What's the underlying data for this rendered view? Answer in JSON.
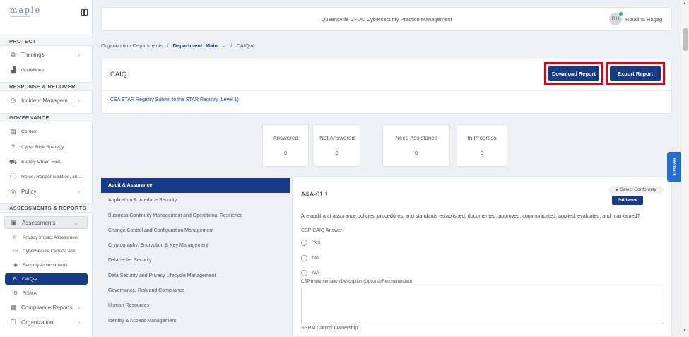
{
  "sidebar": {
    "logo": "maple",
    "sections": {
      "protect": "PROTECT",
      "respond": "RESPONSE & RECOVER",
      "governance": "GOVERNANCE",
      "assessments": "ASSESSMENTS & REPORTS"
    },
    "items": {
      "trainings": "Trainings",
      "guidelines": "Guidelines",
      "incident": "Incident Managem...",
      "context": "Context",
      "cyber_risk": "Cyber Risk Strategy",
      "supply_chain": "Supply Chain Risk",
      "roles": "Roles, Responsibilities, an...",
      "policy": "Policy",
      "assessments": "Assessments",
      "privacy": "Privacy Impact Assessment",
      "cybersecure": "CyberSecure Canada Ass...",
      "security": "Security Assessments",
      "caiqv4": "CAIQv4",
      "fisma": "FISMA",
      "compliance": "Compliance Reports",
      "organization": "Organization"
    }
  },
  "header": {
    "title": "Queensville CFDC Cybersecurity Practice Management",
    "avatar_initials": "R H",
    "user_name": "Roudina Hagag"
  },
  "breadcrumb": {
    "root": "Organization Departments",
    "sep": "/",
    "department": "Department: Main",
    "current": "CAIQv4"
  },
  "caiq_card": {
    "title": "CAIQ",
    "download_label": "Download Report",
    "export_label": "Export Report",
    "link_text": "CSA STAR Registry Submit to the STAR Registry (Level 1)"
  },
  "stats": [
    {
      "label": "Answered",
      "value": "0"
    },
    {
      "label": "Not Answered",
      "value": "8"
    },
    {
      "label": "Need Assistance",
      "value": "0"
    },
    {
      "label": "In Progress",
      "value": "0"
    }
  ],
  "categories": [
    "Audit & Assurance",
    "Application & Interface Security",
    "Business Continuity Management and Operational Resilience",
    "Change Control and Configuration Management",
    "Cryptography, Encryption & Key Management",
    "Datacenter Security",
    "Data Security and Privacy Lifecycle Management",
    "Governance, Risk and Compliance",
    "Human Resources",
    "Identity & Access Management"
  ],
  "question": {
    "id": "A&A-01.1",
    "conformity": "Select Conformity",
    "evidence_label": "Evidence",
    "text": "Are audit and assurance policies, procedures, and standards established, documented, approved, communicated, applied, evaluated, and maintained?",
    "answer_label": "CSP CAIQ Answer",
    "options": [
      "Yes",
      "No",
      "NA"
    ],
    "impl_label": "CSP Implementation Description (Optional/Recommended)",
    "ssrm_label": "SSRM Control Ownership"
  },
  "feedback_label": "Feedback"
}
